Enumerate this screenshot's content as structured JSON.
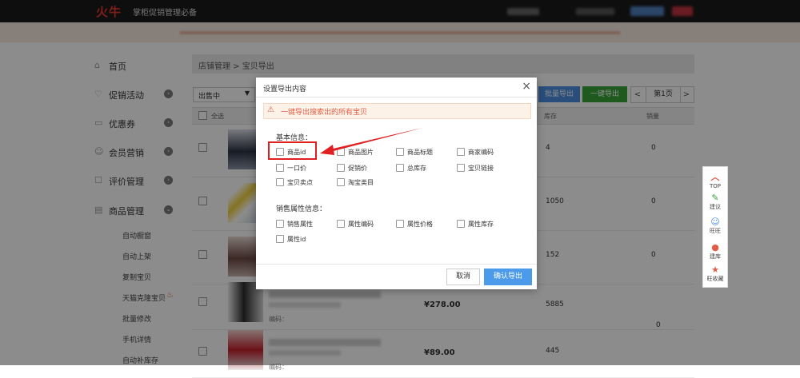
{
  "header": {
    "logo": "火牛",
    "slogan": "掌柜促销管理必备"
  },
  "sidebar": {
    "items": [
      {
        "icon": "home-icon",
        "glyph": "⌂",
        "label": "首页",
        "has_dot": false
      },
      {
        "icon": "promotion-icon",
        "glyph": "♡",
        "label": "促销活动",
        "has_dot": true
      },
      {
        "icon": "coupon-icon",
        "glyph": "▭",
        "label": "优惠券",
        "has_dot": true
      },
      {
        "icon": "member-icon",
        "glyph": "☺",
        "label": "会员营销",
        "has_dot": true
      },
      {
        "icon": "review-icon",
        "glyph": "☐",
        "label": "评价管理",
        "has_dot": true
      },
      {
        "icon": "goods-icon",
        "glyph": "▤",
        "label": "商品管理",
        "has_dot": true
      }
    ],
    "subitems": [
      "自动橱窗",
      "自动上架",
      "复制宝贝",
      "天猫克隆宝贝",
      "批量修改",
      "手机详情",
      "自动补库存"
    ]
  },
  "breadcrumb": "店铺管理 > 宝贝导出",
  "toolbar": {
    "filter_value": "出售中",
    "batch_export": "批量导出",
    "one_click_export": "一键导出",
    "page": "第1页",
    "prev": "<",
    "next": ">"
  },
  "table": {
    "headers": {
      "select_all": "全选",
      "stock": "库存",
      "sales": "销量"
    },
    "rows": [
      {
        "price": "",
        "sub_label": "",
        "stock": "4",
        "sales": "0"
      },
      {
        "price": "",
        "sub_label": "",
        "stock": "1050",
        "sales": "0"
      },
      {
        "price": "",
        "sub_label": "",
        "stock": "152",
        "sales": "0"
      },
      {
        "price": "¥278.00",
        "sub_label": "编码：",
        "stock": "5885",
        "sales": ""
      },
      {
        "price": "¥89.00",
        "sub_label": "编码：",
        "stock": "445",
        "sales": ""
      }
    ],
    "floating_zero": "0"
  },
  "float_tools": {
    "top": "TOP",
    "suggest": "建议",
    "wangwang": "旺旺",
    "suggest2": "建库",
    "favorite": "旺收藏"
  },
  "modal": {
    "title": "设置导出内容",
    "close": "×",
    "notice": "一键导出搜索出的所有宝贝",
    "basic_title": "基本信息：",
    "basic_options": [
      "商品id",
      "商品图片",
      "商品标题",
      "商家编码",
      "一口价",
      "促销价",
      "总库存",
      "宝贝链接",
      "宝贝卖点",
      "淘宝类目"
    ],
    "sales_title": "销售属性信息：",
    "sales_options": [
      "销售属性",
      "属性编码",
      "属性价格",
      "属性库存",
      "属性id"
    ],
    "cancel": "取消",
    "confirm": "确认导出"
  }
}
